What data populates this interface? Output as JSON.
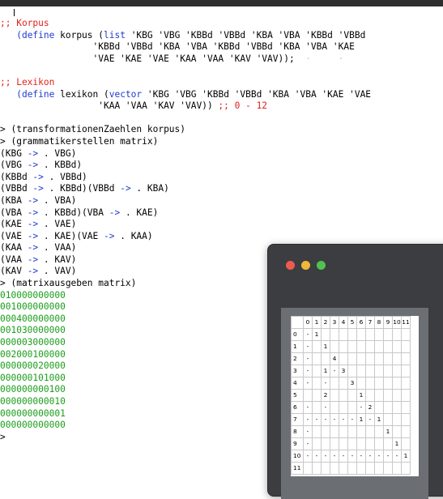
{
  "editor": {
    "lines": [
      {
        "segments": [
          {
            "t": ";; Korpus",
            "c": "comment"
          }
        ]
      },
      {
        "segments": [
          {
            "t": "   (",
            "c": "kw"
          },
          {
            "t": "define",
            "c": "kw"
          },
          {
            "t": " korpus (",
            "c": "qs"
          },
          {
            "t": "list",
            "c": "kw"
          },
          {
            "t": " 'KBG 'VBG 'KBBd 'VBBd 'KBA 'VBA 'KBBd 'VBBd",
            "c": "qs"
          }
        ]
      },
      {
        "segments": [
          {
            "t": "                 'KBBd 'VBBd 'KBA 'VBA 'KBBd 'VBBd 'KBA 'VBA 'KAE",
            "c": "qs"
          }
        ]
      },
      {
        "segments": [
          {
            "t": "                 'VAE 'KAE 'VAE 'KAA 'VAA 'KAV 'VAV));",
            "c": "qs"
          },
          {
            "t": "  ·     ·",
            "c": "dim"
          }
        ]
      },
      {
        "segments": [
          {
            "t": "",
            "c": "qs"
          }
        ]
      },
      {
        "segments": [
          {
            "t": ";; Lexikon",
            "c": "comment"
          }
        ]
      },
      {
        "segments": [
          {
            "t": "   (",
            "c": "kw"
          },
          {
            "t": "define",
            "c": "kw"
          },
          {
            "t": " lexikon (",
            "c": "qs"
          },
          {
            "t": "vector",
            "c": "kw"
          },
          {
            "t": " 'KBG 'VBG 'KBBd 'VBBd 'KBA 'VBA 'KAE 'VAE",
            "c": "qs"
          }
        ]
      },
      {
        "segments": [
          {
            "t": "                  'KAA 'VAA 'KAV 'VAV)) ",
            "c": "qs"
          },
          {
            "t": ";; 0 - 12",
            "c": "comment"
          }
        ]
      },
      {
        "segments": [
          {
            "t": "",
            "c": "qs"
          }
        ]
      },
      {
        "segments": [
          {
            "t": "> (transformationenZaehlen korpus)",
            "c": "prompt"
          }
        ]
      },
      {
        "segments": [
          {
            "t": "> (grammatikerstellen matrix)",
            "c": "prompt"
          }
        ]
      },
      {
        "segments": [
          {
            "t": "(KBG ",
            "c": "qs"
          },
          {
            "t": "->",
            "c": "arrow"
          },
          {
            "t": " . VBG)",
            "c": "qs"
          }
        ]
      },
      {
        "segments": [
          {
            "t": "(VBG ",
            "c": "qs"
          },
          {
            "t": "->",
            "c": "arrow"
          },
          {
            "t": " . KBBd)",
            "c": "qs"
          }
        ]
      },
      {
        "segments": [
          {
            "t": "(KBBd ",
            "c": "qs"
          },
          {
            "t": "->",
            "c": "arrow"
          },
          {
            "t": " . VBBd)",
            "c": "qs"
          }
        ]
      },
      {
        "segments": [
          {
            "t": "(VBBd ",
            "c": "qs"
          },
          {
            "t": "->",
            "c": "arrow"
          },
          {
            "t": " . KBBd)(VBBd ",
            "c": "qs"
          },
          {
            "t": "->",
            "c": "arrow"
          },
          {
            "t": " . KBA)",
            "c": "qs"
          }
        ]
      },
      {
        "segments": [
          {
            "t": "(KBA ",
            "c": "qs"
          },
          {
            "t": "->",
            "c": "arrow"
          },
          {
            "t": " . VBA)",
            "c": "qs"
          }
        ]
      },
      {
        "segments": [
          {
            "t": "(VBA ",
            "c": "qs"
          },
          {
            "t": "->",
            "c": "arrow"
          },
          {
            "t": " . KBBd)(VBA ",
            "c": "qs"
          },
          {
            "t": "->",
            "c": "arrow"
          },
          {
            "t": " . KAE)",
            "c": "qs"
          }
        ]
      },
      {
        "segments": [
          {
            "t": "(KAE ",
            "c": "qs"
          },
          {
            "t": "->",
            "c": "arrow"
          },
          {
            "t": " . VAE)",
            "c": "qs"
          }
        ]
      },
      {
        "segments": [
          {
            "t": "(VAE ",
            "c": "qs"
          },
          {
            "t": "->",
            "c": "arrow"
          },
          {
            "t": " . KAE)(VAE ",
            "c": "qs"
          },
          {
            "t": "->",
            "c": "arrow"
          },
          {
            "t": " . KAA)",
            "c": "qs"
          }
        ]
      },
      {
        "segments": [
          {
            "t": "(KAA ",
            "c": "qs"
          },
          {
            "t": "->",
            "c": "arrow"
          },
          {
            "t": " . VAA)",
            "c": "qs"
          }
        ]
      },
      {
        "segments": [
          {
            "t": "(VAA ",
            "c": "qs"
          },
          {
            "t": "->",
            "c": "arrow"
          },
          {
            "t": " . KAV)",
            "c": "qs"
          }
        ]
      },
      {
        "segments": [
          {
            "t": "(KAV ",
            "c": "qs"
          },
          {
            "t": "->",
            "c": "arrow"
          },
          {
            "t": " . VAV)",
            "c": "qs"
          }
        ]
      },
      {
        "segments": [
          {
            "t": "> (matrixausgeben matrix)",
            "c": "prompt"
          }
        ]
      },
      {
        "segments": [
          {
            "t": "010000000000",
            "c": "ret"
          }
        ]
      },
      {
        "segments": [
          {
            "t": "001000000000",
            "c": "ret"
          }
        ]
      },
      {
        "segments": [
          {
            "t": "000400000000",
            "c": "ret"
          }
        ]
      },
      {
        "segments": [
          {
            "t": "001030000000",
            "c": "ret"
          }
        ]
      },
      {
        "segments": [
          {
            "t": "000003000000",
            "c": "ret"
          }
        ]
      },
      {
        "segments": [
          {
            "t": "002000100000",
            "c": "ret"
          }
        ]
      },
      {
        "segments": [
          {
            "t": "000000020000",
            "c": "ret"
          }
        ]
      },
      {
        "segments": [
          {
            "t": "000000101000",
            "c": "ret"
          }
        ]
      },
      {
        "segments": [
          {
            "t": "000000000100",
            "c": "ret"
          }
        ]
      },
      {
        "segments": [
          {
            "t": "000000000010",
            "c": "ret"
          }
        ]
      },
      {
        "segments": [
          {
            "t": "000000000001",
            "c": "ret"
          }
        ]
      },
      {
        "segments": [
          {
            "t": "000000000000",
            "c": "ret"
          }
        ]
      },
      {
        "segments": [
          {
            "t": ">",
            "c": "prompt"
          }
        ]
      }
    ]
  },
  "window": {
    "lights": [
      {
        "name": "close-light",
        "color": "#ec5b52"
      },
      {
        "name": "minimize-light",
        "color": "#f2b63a"
      },
      {
        "name": "zoom-light",
        "color": "#4fc24f"
      }
    ]
  },
  "grid": {
    "header": [
      "",
      "0",
      "1",
      "2",
      "3",
      "4",
      "5",
      "6",
      "7",
      "8",
      "9",
      "10",
      "11"
    ],
    "rows": [
      [
        "0",
        "-",
        "1",
        "",
        "",
        "",
        "",
        "",
        "",
        "",
        "",
        "",
        ""
      ],
      [
        "1",
        "-",
        "",
        "1",
        "",
        "",
        "",
        "",
        "",
        "",
        "",
        "",
        ""
      ],
      [
        "2",
        "-",
        "",
        "",
        "4",
        "",
        "",
        "",
        "",
        "",
        "",
        "",
        ""
      ],
      [
        "3",
        "-",
        "",
        "1",
        "-",
        "3",
        "",
        "",
        "",
        "",
        "",
        "",
        ""
      ],
      [
        "4",
        "-",
        "",
        "-",
        "",
        "",
        "3",
        "",
        "",
        "",
        "",
        "",
        ""
      ],
      [
        "5",
        "",
        "",
        "2",
        "",
        "",
        "",
        "1",
        "",
        "",
        "",
        "",
        ""
      ],
      [
        "6",
        "-",
        "",
        "-",
        "",
        "",
        "",
        "-",
        "2",
        "",
        "",
        "",
        ""
      ],
      [
        "7",
        "-",
        "-",
        "-",
        "-",
        "-",
        "-",
        "1",
        "-",
        "1",
        "",
        "",
        ""
      ],
      [
        "8",
        "-",
        "",
        "",
        "",
        "",
        "",
        "",
        "",
        "",
        "1",
        "",
        ""
      ],
      [
        "9",
        "-",
        "",
        "",
        "",
        "",
        "",
        "",
        "",
        "",
        "",
        "1",
        ""
      ],
      [
        "10",
        "-",
        "-",
        "-",
        "-",
        "-",
        "-",
        "-",
        "-",
        "-",
        "-",
        "-",
        "1"
      ],
      [
        "11",
        "",
        "",
        "",
        "",
        "",
        "",
        "",
        "",
        "",
        "",
        "",
        ""
      ]
    ]
  }
}
